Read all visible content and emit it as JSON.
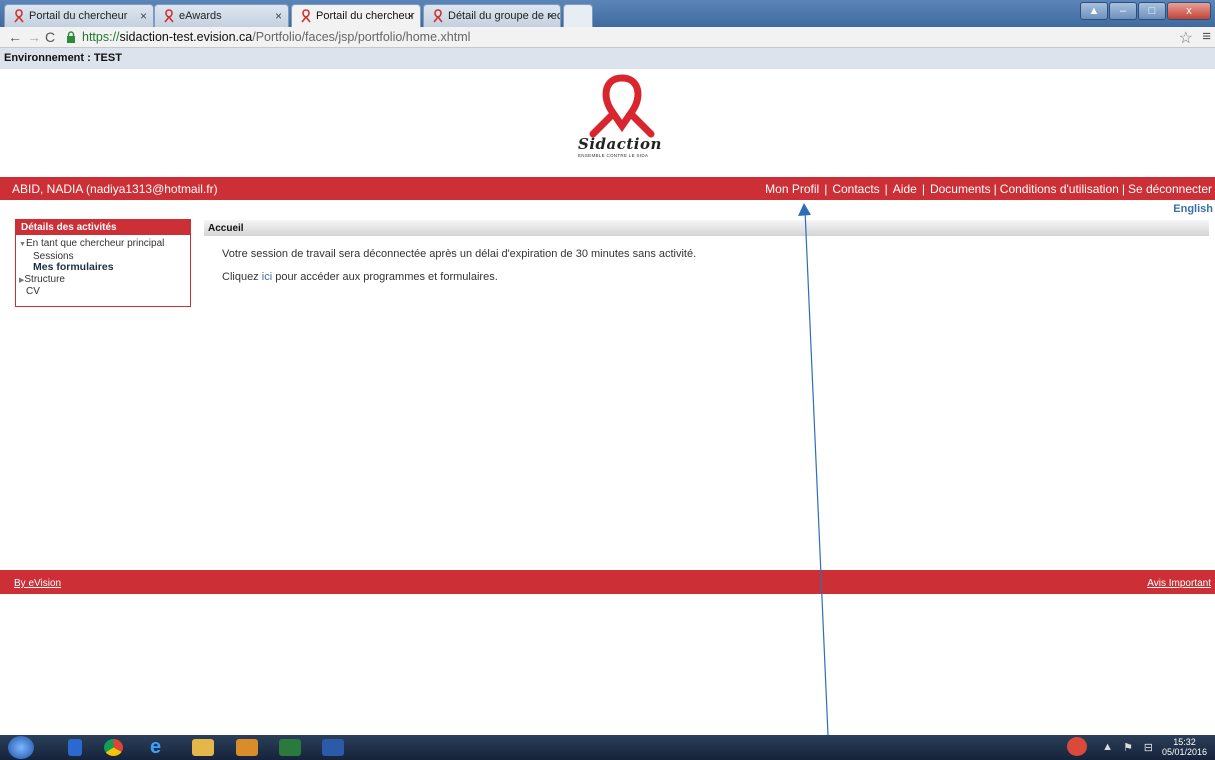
{
  "browser": {
    "tabs": [
      {
        "label": "Portail du chercheur"
      },
      {
        "label": "eAwards"
      },
      {
        "label": "Portail du chercheur"
      },
      {
        "label": "Détail du groupe de reche"
      }
    ],
    "close_glyph": "×",
    "url_scheme": "https://",
    "url_host": "sidaction-test.evision.ca",
    "url_path": "/Portfolio/faces/jsp/portfolio/home.xhtml"
  },
  "page": {
    "environment": "Environnement : TEST",
    "logo_text": "Sidaction",
    "logo_subtext": "ENSEMBLE CONTRE LE SIDA",
    "user": "ABID, NADIA (nadiya1313@hotmail.fr)",
    "header_links": [
      "Mon Profil",
      "Contacts",
      "Aide",
      "Documents",
      "Conditions d'utilisation",
      "Se déconnecter"
    ],
    "language": "English",
    "sidebar": {
      "title": "Détails des activités",
      "group": "En tant que chercheur principal",
      "items": [
        "Sessions",
        "Mes formulaires"
      ],
      "structure": "Structure",
      "cv": "CV"
    },
    "main": {
      "title": "Accueil",
      "message1": "Votre session de travail sera déconnectée après un délai d'expiration de 30 minutes sans activité.",
      "message2_prefix": "Cliquez",
      "message2_link": "ici",
      "message2_suffix": "pour accéder aux programmes et formulaires."
    },
    "footer": {
      "left": "By eVision",
      "right": "Avis Important"
    }
  },
  "taskbar": {
    "time": "15:32",
    "date": "05/01/2016"
  },
  "colors": {
    "brand_red": "#cc2f35",
    "link_blue": "#3c6fa8",
    "annotation_arrow": "#2e6db8"
  }
}
